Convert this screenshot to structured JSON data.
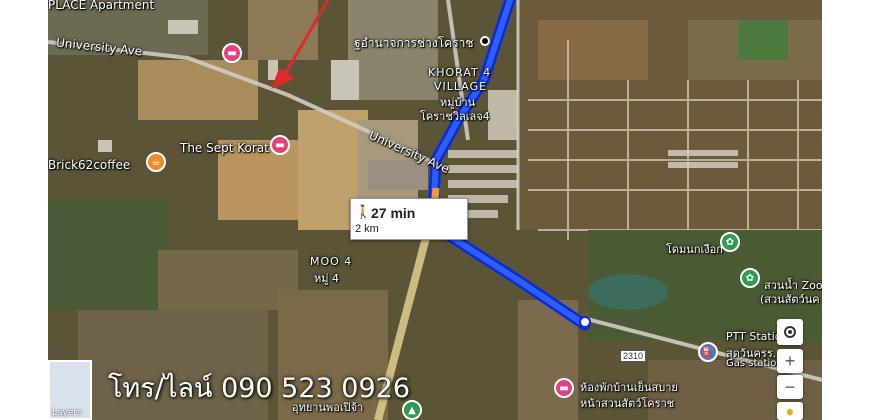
{
  "map": {
    "labels": {
      "apartment": "PLACE Apartment",
      "university_ave_1": "University Ave",
      "university_ave_2": "University Ave",
      "brick62": "Brick62coffee",
      "sept_korat": "The Sept Korat",
      "police_school": "ฐอำนาจการช่างโคราช",
      "khorat_village_1": "KHORAT 4",
      "khorat_village_2": "VILLAGE",
      "khorat_village_3": "หมู่บ้าน",
      "khorat_village_4": "โคราชวิลเลจ4",
      "moo4_1": "MOO 4",
      "moo4_2": "หมู่ 4",
      "zoo_1": "โดมนกเงือก",
      "zoo_2": "สวนน้ำ Zoo",
      "zoo_3": "(สวนสัตว์นค",
      "ptt_1": "PTT Station",
      "ptt_2": "สุดว้นครร...",
      "ptt_3": "Gas station",
      "hotel_1": "ห้องพักบ้านเย็นสบาย",
      "hotel_2": "หน้าสวนสัตว์โคราช",
      "park_1": "อุทยานพอเปิจ้า",
      "road_number": "2310"
    },
    "route": {
      "time": "27 min",
      "distance": "2 km",
      "mode_icon": "walking-icon",
      "color": "#1a3ff0"
    },
    "watermark": "โทร/ไลน์ 090 523 0926",
    "layers_label": "Layers",
    "controls": {
      "zoom_in": "+",
      "zoom_out": "−",
      "locate_icon": "locate-icon",
      "pegman_icon": "pegman-icon"
    }
  }
}
